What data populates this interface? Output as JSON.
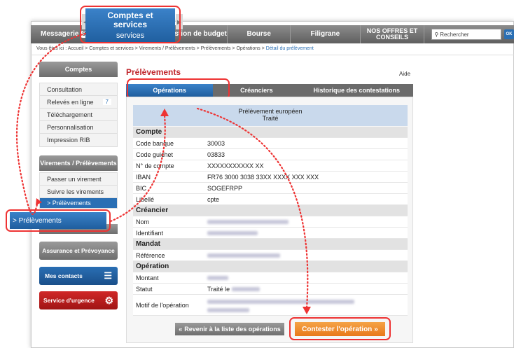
{
  "nav": {
    "messagerie_label": "Messagerie",
    "messagerie_count": "99+",
    "services_label": "services",
    "budget_label": "Gestion de budget",
    "bourse_label": "Bourse",
    "filigrane_label": "Filigrane",
    "offres_label": "NOS OFFRES ET CONSEILS",
    "search_placeholder": "Rechercher",
    "search_ok": "OK"
  },
  "highlight_tab": {
    "line1": "Comptes et",
    "line2": "services",
    "sub": "services"
  },
  "breadcrumb": {
    "prefix": "Vous êtes ici :",
    "path": "Accueil > Comptes et services > Virements / Prélèvements > Prélèvements > Opérations > ",
    "current": "Détail du prélèvement"
  },
  "sidebar": {
    "comptes_title": "Comptes",
    "comptes_items": [
      {
        "label": "Consultation",
        "count": ""
      },
      {
        "label": "Relevés en ligne",
        "count": "7"
      },
      {
        "label": "Téléchargement",
        "count": ""
      },
      {
        "label": "Personnalisation",
        "count": ""
      },
      {
        "label": "Impression RIB",
        "count": ""
      }
    ],
    "virements_title": "Virements / Prélèvements",
    "virements_items": [
      {
        "label": "Passer un virement"
      },
      {
        "label": "Suivre les virements"
      },
      {
        "label": "> Prélèvements"
      }
    ],
    "prel_callout": "> Prélèvements",
    "assurance": "Assurance et Prévoyance",
    "contacts": "Mes contacts",
    "urgence": "Service d'urgence"
  },
  "main": {
    "title": "Prélèvements",
    "aide": "Aide",
    "tabs": [
      "Opérations",
      "Créanciers",
      "Historique des contestations"
    ],
    "detail_title": "Prélèvement européen",
    "detail_status": "Traité",
    "sections": {
      "compte": "Compte",
      "creancier": "Créancier",
      "mandat": "Mandat",
      "operation": "Opération"
    },
    "compte_rows": [
      {
        "label": "Code banque",
        "value": "30003"
      },
      {
        "label": "Code guichet",
        "value": "03833"
      },
      {
        "label": "N° de compte",
        "value": "XXXXXXXXXXX XX"
      },
      {
        "label": "IBAN",
        "value": "FR76 3000 3038 33XX XXXX XXX XXX"
      },
      {
        "label": "BIC",
        "value": "SOGEFRPP"
      },
      {
        "label": "Libellé",
        "value": "cpte"
      }
    ],
    "creancier_rows": [
      {
        "label": "Nom"
      },
      {
        "label": "Identifiant"
      }
    ],
    "mandat_rows": [
      {
        "label": "Référence"
      }
    ],
    "operation_rows": [
      {
        "label": "Montant",
        "value": ""
      },
      {
        "label": "Statut",
        "value": "Traité le"
      },
      {
        "label": "Motif de l'opération",
        "value": ""
      }
    ],
    "back_button": "Revenir à la liste des opérations",
    "contest_button": "Contester l'opération"
  },
  "colors": {
    "accent_blue": "#2a6fb4",
    "title_red": "#c0262c",
    "callout_red": "#e33333",
    "contest_orange": "#e8791a"
  }
}
